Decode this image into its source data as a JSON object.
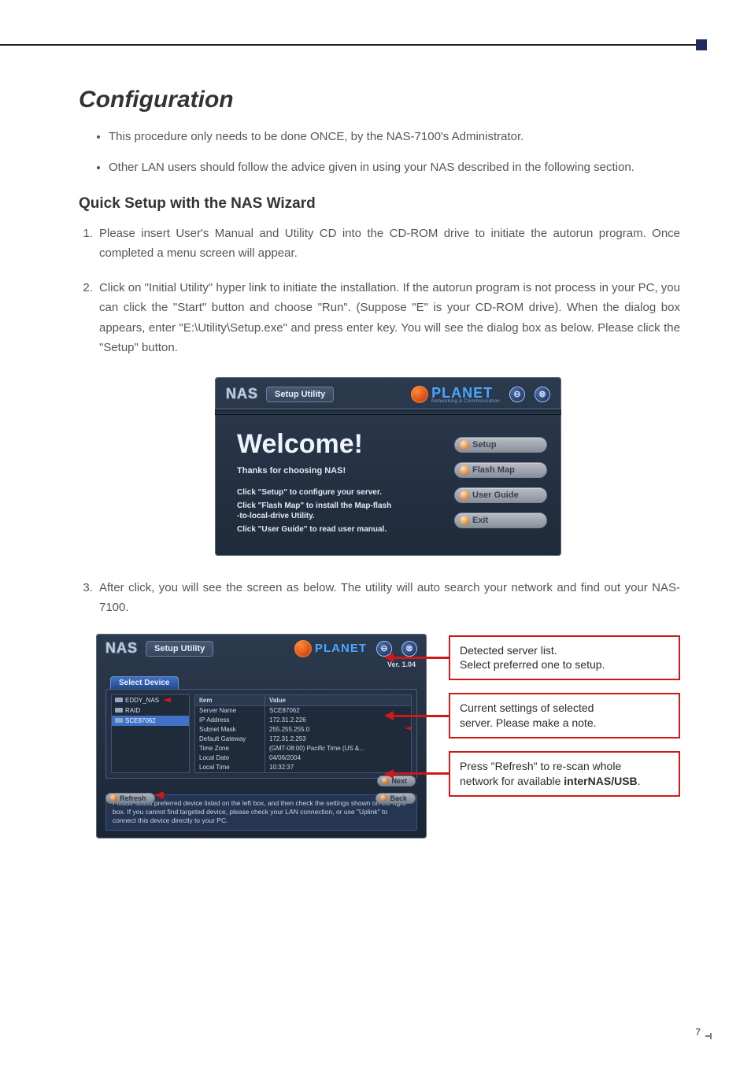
{
  "page": {
    "number": "7",
    "title": "Configuration"
  },
  "bullets": [
    "This procedure only needs to be done ONCE, by the NAS-7100's Administrator.",
    "Other LAN users should follow the advice given in using your NAS described in the following section."
  ],
  "subhead": "Quick Setup with the NAS Wizard",
  "steps": [
    "Please insert User's Manual and Utility CD into the CD-ROM drive to initiate the autorun program. Once completed a menu screen will appear.",
    "Click on \"Initial Utility\" hyper link to initiate the installation. If the autorun program is not process in your PC, you can click the \"Start\" button and choose \"Run\". (Suppose \"E\" is your CD-ROM drive). When the dialog box appears, enter \"E:\\Utility\\Setup.exe\" and press enter key. You will see the dialog box as below. Please click the \"Setup\" button.",
    "After click, you will see the screen as below. The utility will auto search your network and find out your NAS-7100."
  ],
  "fig1": {
    "app_badge": "NAS",
    "app_tab": "Setup Utility",
    "brand_text": "PLANET",
    "brand_sub": "Networking & Communication",
    "welcome_heading": "Welcome!",
    "thanks_line": "Thanks for choosing NAS!",
    "line1": "Click \"Setup\" to configure your server.",
    "line2a": "Click \"Flash Map\" to install the Map-flash",
    "line2b": "-to-local-drive Utility.",
    "line3": "Click \"User Guide\" to read user manual.",
    "buttons": {
      "setup": "Setup",
      "flash_map": "Flash Map",
      "user_guide": "User Guide",
      "exit": "Exit"
    },
    "minimize_glyph": "⊖",
    "close_glyph": "⊗"
  },
  "fig2": {
    "app_badge": "NAS",
    "app_tab": "Setup Utility",
    "brand_text": "PLANET",
    "version_label": "Ver. 1.04",
    "select_device_tab": "Select Device",
    "device_list": [
      "EDDY_NAS",
      "RAID",
      "SCE87062"
    ],
    "selected_device_index": 2,
    "table_headers": {
      "item": "Item",
      "value": "Value"
    },
    "rows": [
      {
        "k": "Server Name",
        "v": "SCE87062"
      },
      {
        "k": "IP Address",
        "v": "172.31.2.226"
      },
      {
        "k": "Subnet Mask",
        "v": "255.255.255.0"
      },
      {
        "k": "Default Gateway",
        "v": "172.31.2.253"
      },
      {
        "k": "Time Zone",
        "v": "(GMT-08:00) Pacific Time (US &..."
      },
      {
        "k": "Local Date",
        "v": "04/06/2004"
      },
      {
        "k": "Local Time",
        "v": "10:32:37"
      }
    ],
    "buttons": {
      "refresh": "Refresh",
      "next": "Next",
      "back": "Back"
    },
    "footer_note": "Please select preferred device listed on the left box, and then check the settings shown on the right box. If you cannot find targeted device, please check your LAN connection, or use \"Uplink\" to connect this device directly to your PC.",
    "minimize_glyph": "⊖",
    "close_glyph": "⊗"
  },
  "callouts": {
    "c1a": "Detected server list.",
    "c1b": "Select preferred one to setup.",
    "c2a": "Current settings of selected",
    "c2b": "server. Please make a note.",
    "c3a": "Press \"Refresh\"  to re-scan whole",
    "c3b_prefix": "network for available ",
    "c3b_bold": "interNAS/USB",
    "c3b_suffix": "."
  }
}
